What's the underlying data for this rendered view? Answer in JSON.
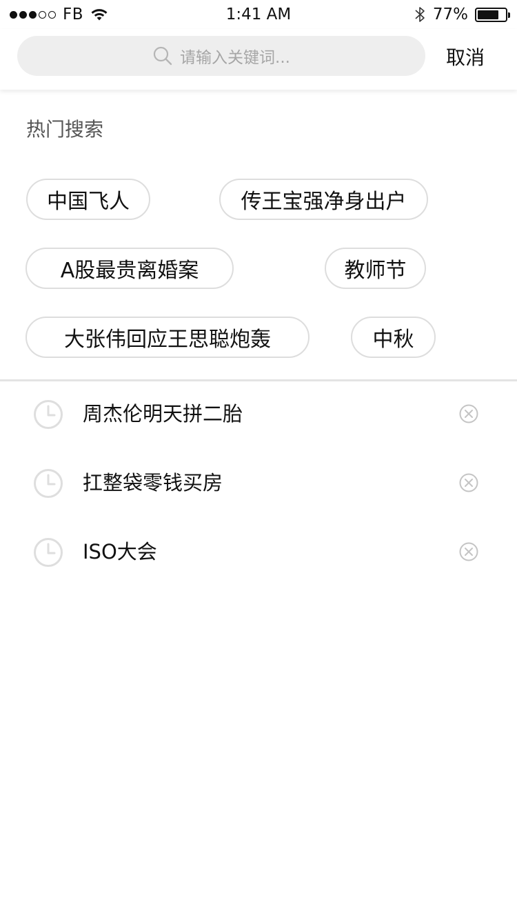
{
  "status_bar": {
    "carrier": "FB",
    "time": "1:41 AM",
    "battery_percent": "77%",
    "battery_level": 0.77,
    "signal_bars_filled": 3,
    "signal_bars_total": 5
  },
  "search": {
    "placeholder": "请输入关键词...",
    "cancel_label": "取消"
  },
  "hot_search": {
    "title": "热门搜索",
    "tags": [
      "中国飞人",
      "传王宝强净身出户",
      "A股最贵离婚案",
      "教师节",
      "大张伟回应王思聪炮轰",
      "中秋"
    ]
  },
  "history": {
    "items": [
      "周杰伦明天拼二胎",
      "扛整袋零钱买房",
      "ISO大会"
    ]
  },
  "icons": {
    "search": "search-icon",
    "clock": "clock-icon",
    "delete": "close-circle-icon",
    "wifi": "wifi-icon",
    "bluetooth": "bluetooth-icon",
    "battery": "battery-icon"
  },
  "colors": {
    "search_box_bg": "#eeeeee",
    "tag_border": "#dddddd",
    "icon_gray": "#c8c8c8",
    "divider": "#e3e3e3",
    "placeholder": "#a6a6a6"
  }
}
